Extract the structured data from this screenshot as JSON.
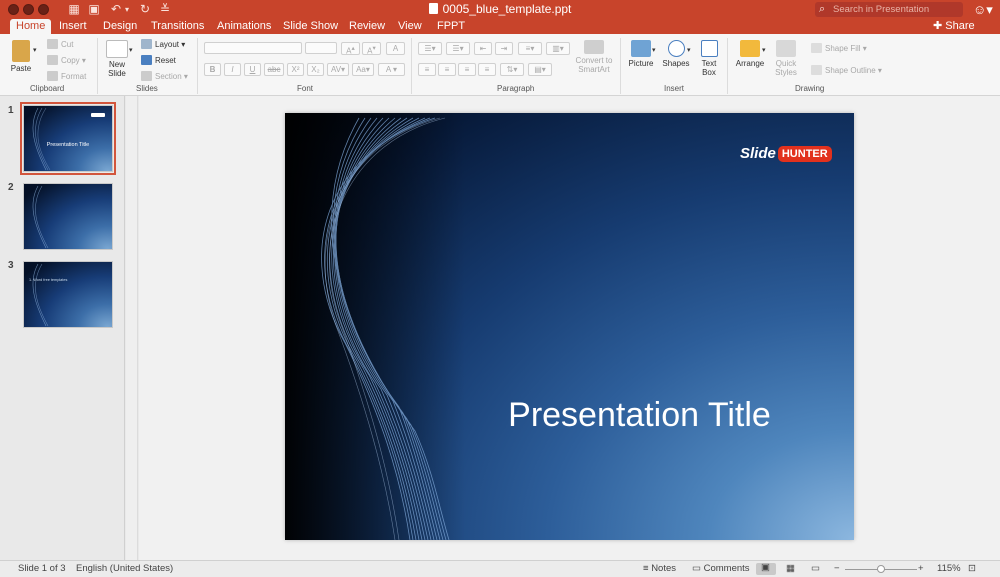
{
  "window": {
    "title": "0005_blue_template.ppt",
    "search_placeholder": "Search in Presentation"
  },
  "tabs": [
    {
      "label": "Home",
      "active": true
    },
    {
      "label": "Insert"
    },
    {
      "label": "Design"
    },
    {
      "label": "Transitions"
    },
    {
      "label": "Animations"
    },
    {
      "label": "Slide Show"
    },
    {
      "label": "Review"
    },
    {
      "label": "View"
    },
    {
      "label": "FPPT"
    }
  ],
  "share_label": "Share",
  "ribbon": {
    "clipboard": {
      "paste": "Paste",
      "cut": "Cut",
      "copy": "Copy",
      "format": "Format",
      "group": "Clipboard"
    },
    "slides": {
      "new_slide_line1": "New",
      "new_slide_line2": "Slide",
      "layout": "Layout",
      "reset": "Reset",
      "section": "Section",
      "group": "Slides"
    },
    "font": {
      "group": "Font"
    },
    "paragraph": {
      "convert_line1": "Convert to",
      "convert_line2": "SmartArt",
      "group": "Paragraph"
    },
    "insert": {
      "picture": "Picture",
      "shapes": "Shapes",
      "textbox_line1": "Text",
      "textbox_line2": "Box",
      "group": "Insert"
    },
    "drawing": {
      "arrange": "Arrange",
      "quick_line1": "Quick",
      "quick_line2": "Styles",
      "shape_fill": "Shape Fill",
      "shape_outline": "Shape Outline",
      "group": "Drawing"
    }
  },
  "thumbnails": [
    {
      "number": "1",
      "title": "Presentation Title",
      "selected": true
    },
    {
      "number": "2"
    },
    {
      "number": "3",
      "text": "1. Word free templates"
    }
  ],
  "slide": {
    "title": "Presentation Title",
    "logo_slide": "Slide",
    "logo_hunter": "HUNTER"
  },
  "status": {
    "slide_info": "Slide 1 of 3",
    "language": "English (United States)",
    "notes": "Notes",
    "comments": "Comments",
    "zoom": "115%"
  },
  "colors": {
    "accent": "#c8442b",
    "logo_red": "#e2311d"
  }
}
